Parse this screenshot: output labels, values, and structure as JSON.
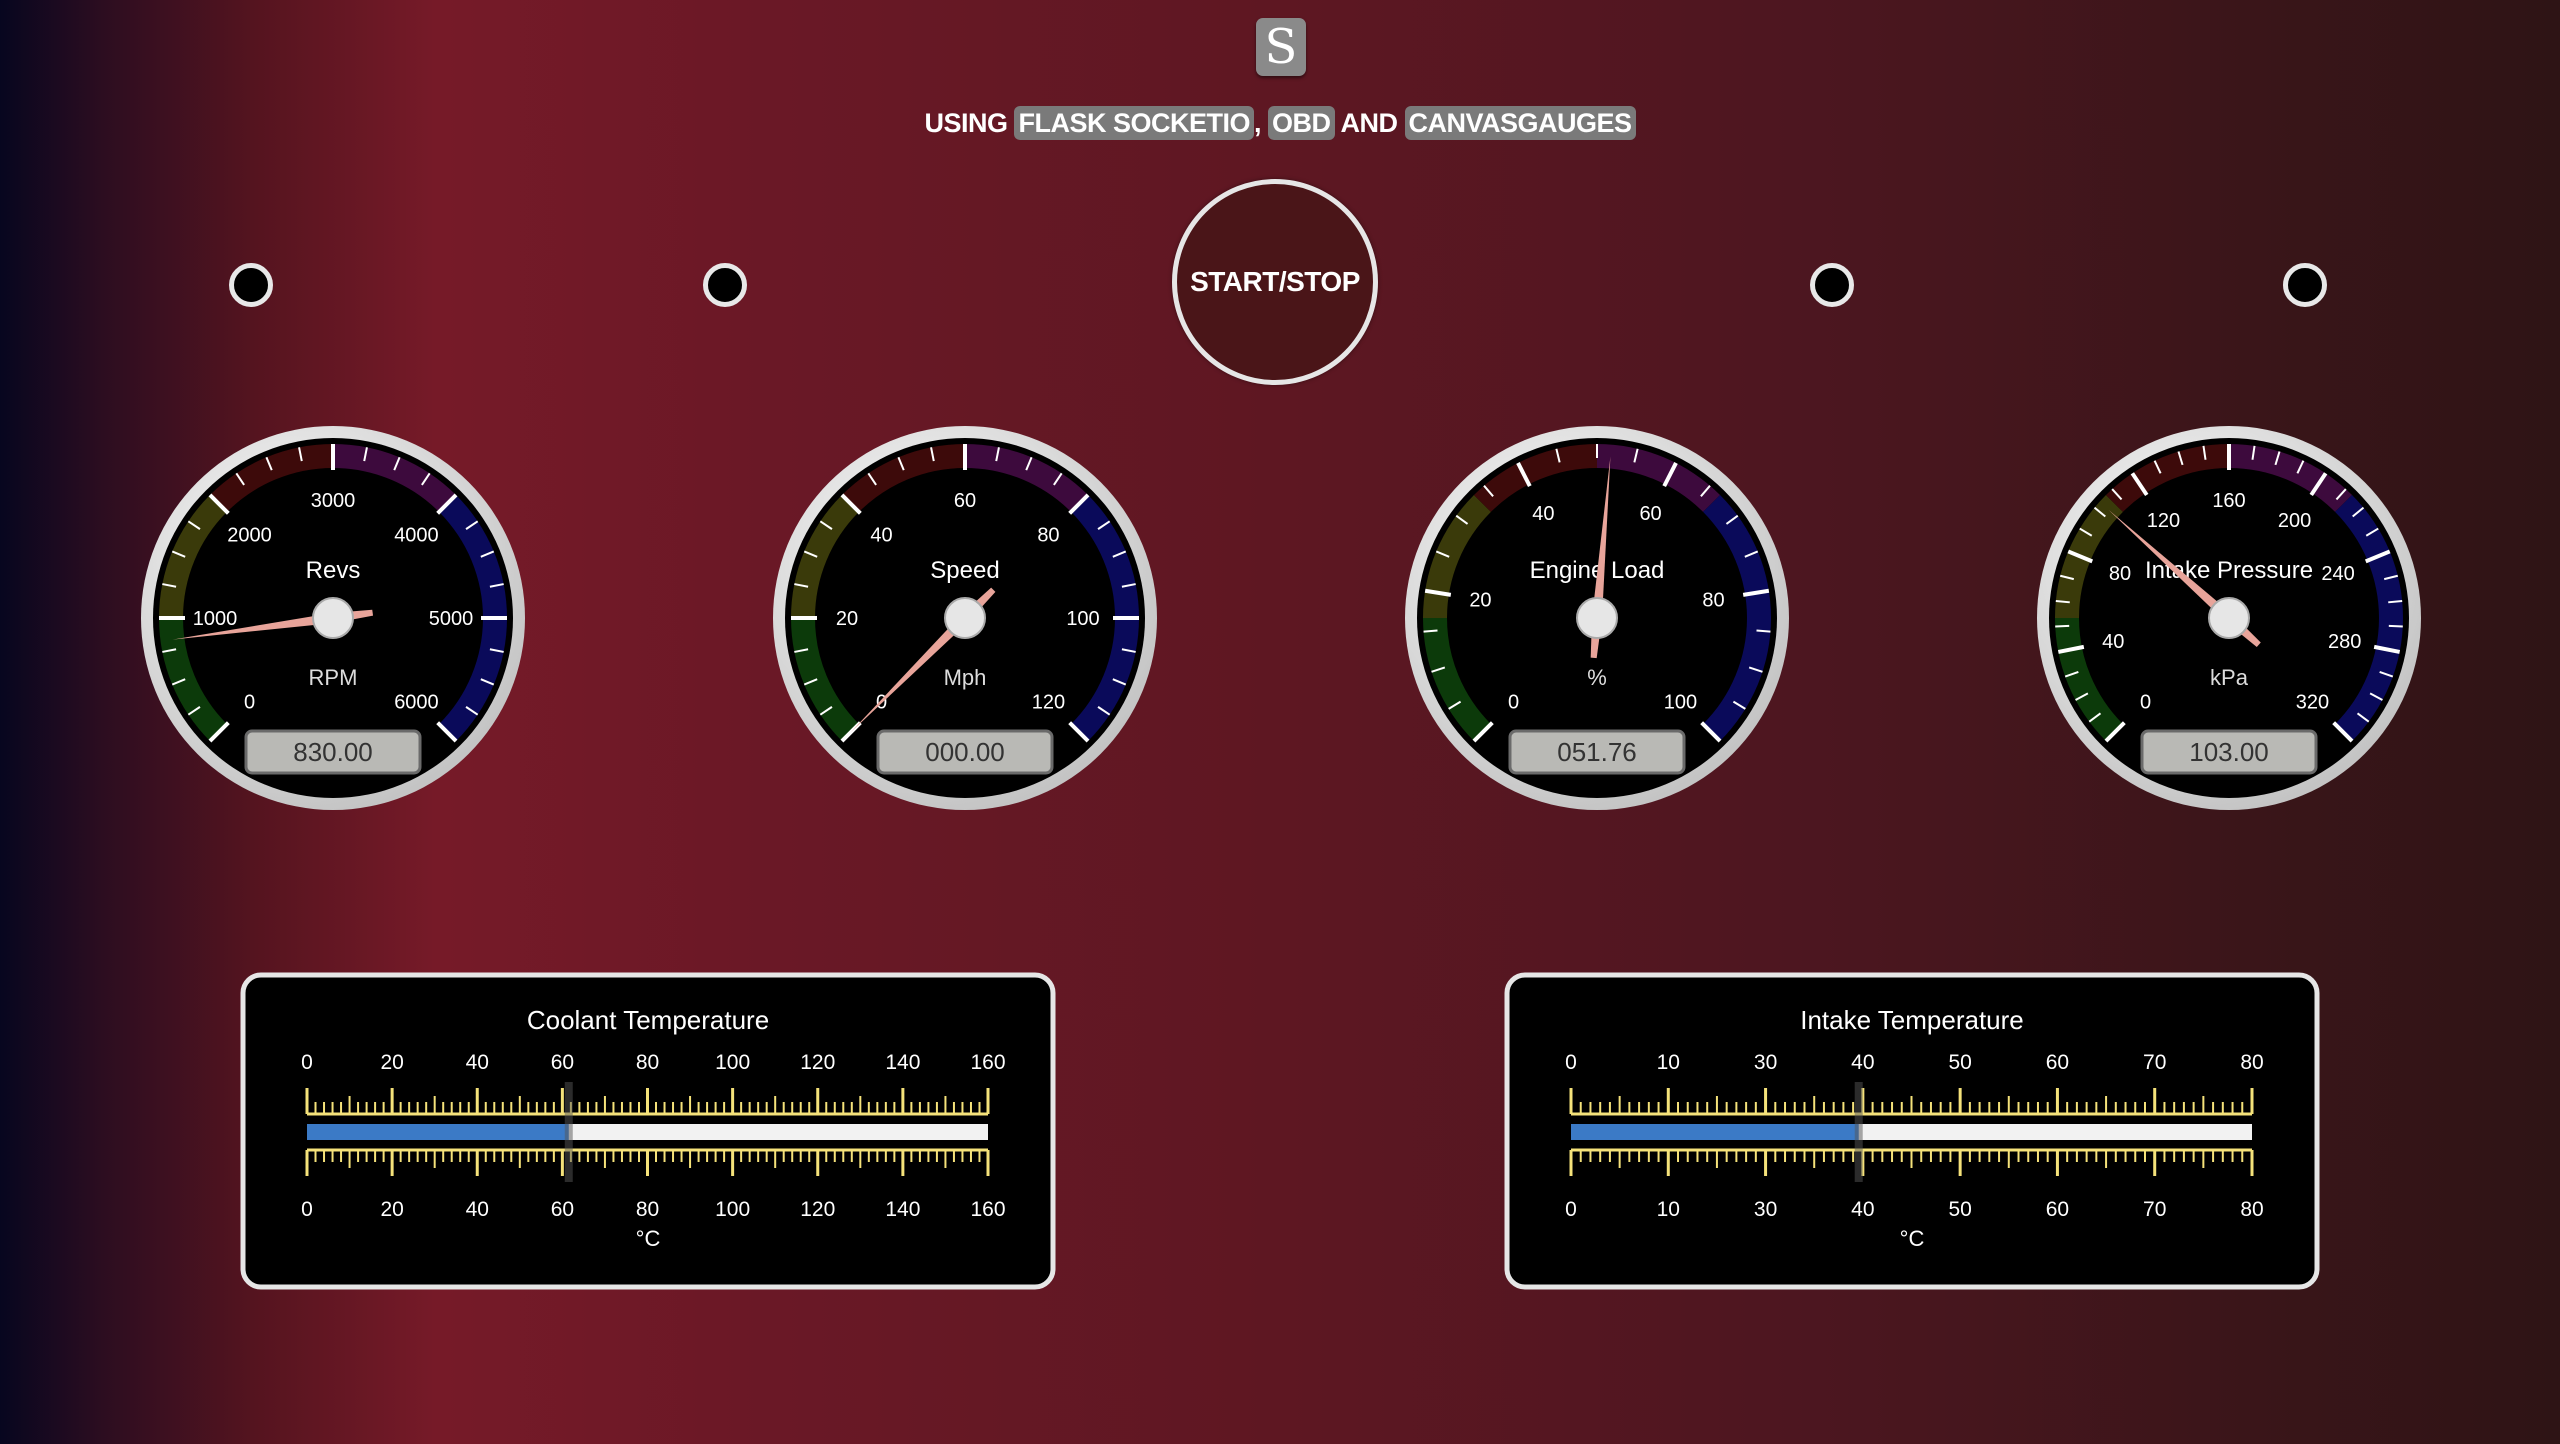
{
  "header": {
    "logo_letter": "S",
    "subtitle_prefix": "Using ",
    "tag_flask": "Flask SocketIO",
    "sep1": ", ",
    "tag_obd": "OBD",
    "sep2": " and ",
    "tag_canvas": "CanvasGauges"
  },
  "start_button": {
    "label": "START/STOP"
  },
  "gauges": [
    {
      "id": "revs",
      "title": "Revs",
      "units": "RPM",
      "display": "830.00",
      "value": 830,
      "min": 0,
      "max": 6000,
      "major": [
        "0",
        "1000",
        "2000",
        "3000",
        "4000",
        "5000",
        "6000"
      ]
    },
    {
      "id": "speed",
      "title": "Speed",
      "units": "Mph",
      "display": "000.00",
      "value": 0,
      "min": 0,
      "max": 120,
      "major": [
        "0",
        "20",
        "40",
        "60",
        "80",
        "100",
        "120"
      ]
    },
    {
      "id": "load",
      "title": "Engine Load",
      "units": "%",
      "display": "051.76",
      "value": 51.76,
      "min": 0,
      "max": 100,
      "major": [
        "0",
        "20",
        "40",
        "60",
        "80",
        "100"
      ]
    },
    {
      "id": "intake-pressure",
      "title": "Intake Pressure",
      "units": "kPa",
      "display": "103.00",
      "value": 103,
      "min": 0,
      "max": 320,
      "major": [
        "0",
        "40",
        "80",
        "120",
        "160",
        "200",
        "240",
        "280",
        "320"
      ]
    }
  ],
  "linear_gauges": [
    {
      "id": "coolant",
      "title": "Coolant Temperature",
      "units": "°C",
      "value": 61.5,
      "min": 0,
      "max": 160,
      "major": [
        "0",
        "20",
        "40",
        "60",
        "80",
        "100",
        "120",
        "140",
        "160"
      ]
    },
    {
      "id": "intake-temp",
      "title": "Intake Temperature",
      "units": "°C",
      "value": 33.8,
      "min": 0,
      "max": 80,
      "major": [
        "0",
        "10",
        "30",
        "40",
        "50",
        "60",
        "70",
        "80"
      ]
    }
  ],
  "colors": {
    "needle": "#e8a49a",
    "bar": "#3b7ac6",
    "tick": "#f5e27a",
    "zone_green": "#0c3a0a",
    "zone_olive": "#3a3a0a",
    "zone_red": "#3d0a0a",
    "zone_purple": "#3d0a3d",
    "zone_blue": "#0a0a5a"
  }
}
